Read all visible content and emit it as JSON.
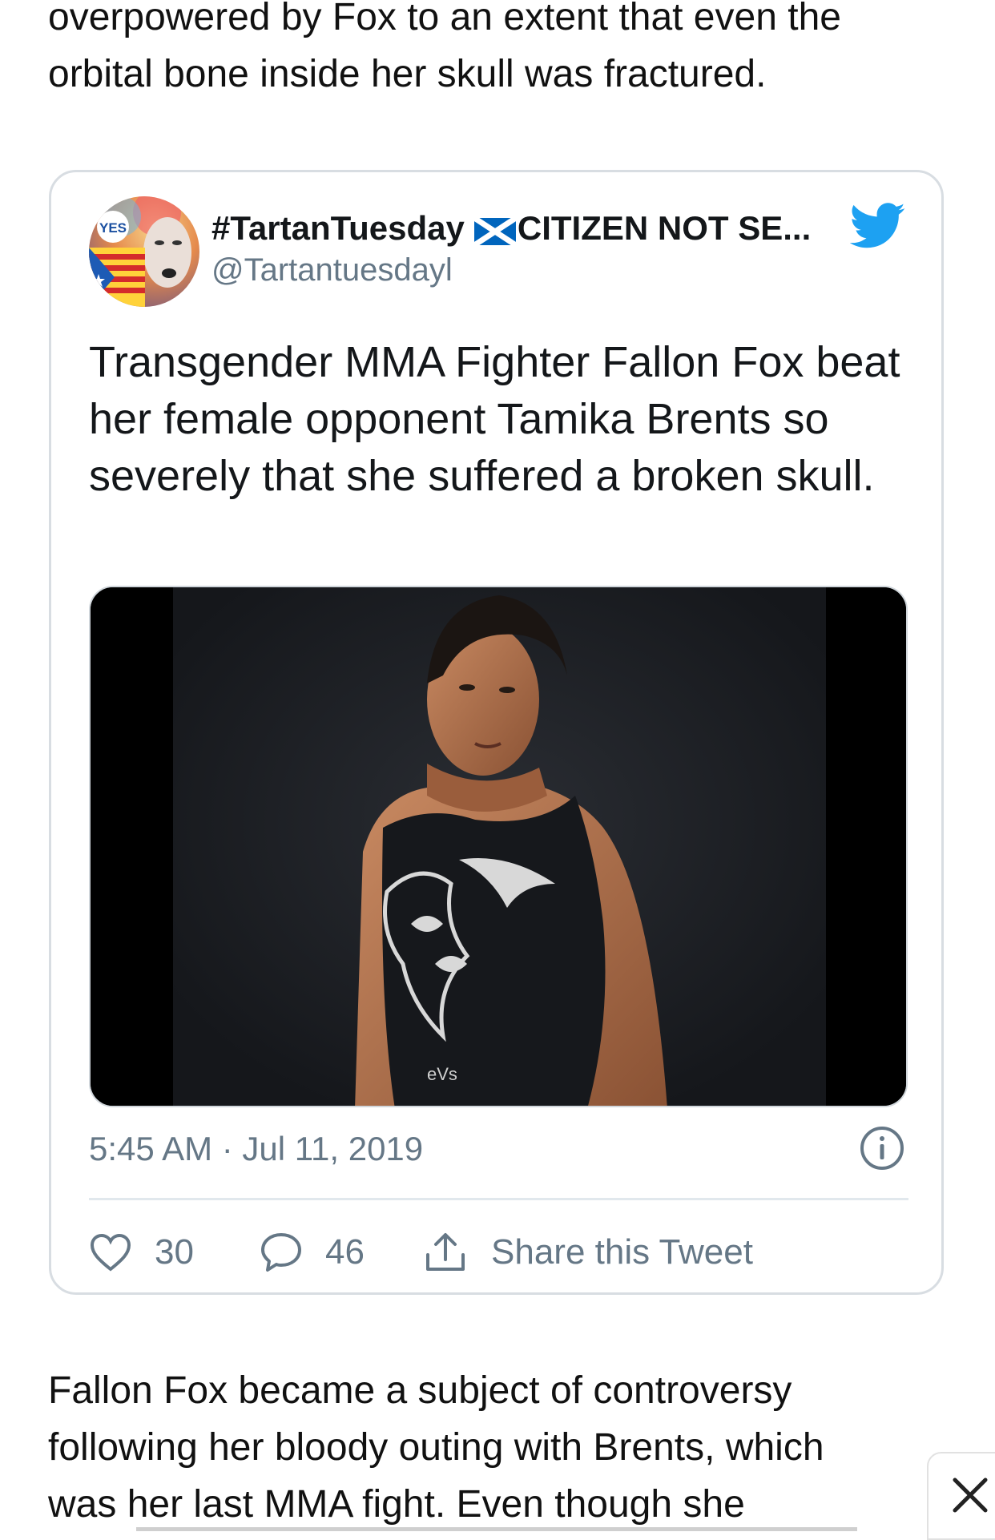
{
  "article": {
    "paragraph_top": "overpowered by Fox to an extent that even the orbital bone inside her skull was fractured.",
    "paragraph_bottom": "Fallon Fox became a subject of controversy following her bloody outing with Brents, which was her last MMA fight. Even though she"
  },
  "tweet": {
    "display_name_part1": "#TartanTuesday",
    "display_name_part2": "CITIZEN NOT SE...",
    "handle": "@Tartantuesdayl",
    "avatar_badge": "YES",
    "text": "Transgender MMA Fighter Fallon Fox beat her female opponent Tamika Brents so severely that she suffered a broken skull.",
    "timestamp": "5:45 AM · Jul 11, 2019",
    "likes": "30",
    "replies": "46",
    "share_label": "Share this Tweet",
    "shirt_text": "eVs",
    "accent_color": "#1da1f2",
    "icons": {
      "brand": "twitter-bird-icon",
      "flag": "scottish-flag-icon",
      "info": "info-icon",
      "like": "heart-icon",
      "reply": "speech-bubble-icon",
      "share": "share-upload-icon",
      "close": "close-icon"
    }
  }
}
